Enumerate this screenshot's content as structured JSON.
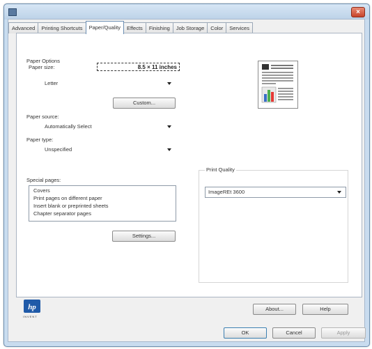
{
  "window": {
    "title": ""
  },
  "tabs": [
    {
      "label": "Advanced",
      "active": false
    },
    {
      "label": "Printing Shortcuts",
      "active": false
    },
    {
      "label": "Paper/Quality",
      "active": true
    },
    {
      "label": "Effects",
      "active": false
    },
    {
      "label": "Finishing",
      "active": false
    },
    {
      "label": "Job Storage",
      "active": false
    },
    {
      "label": "Color",
      "active": false
    },
    {
      "label": "Services",
      "active": false
    }
  ],
  "paper_options": {
    "group_label": "Paper Options",
    "size_label": "Paper size:",
    "size_value": "8.5 × 11 inches",
    "size_combo": "Letter",
    "custom_button": "Custom...",
    "source_label": "Paper source:",
    "source_value": "Automatically Select",
    "type_label": "Paper type:",
    "type_value": "Unspecified"
  },
  "special_pages": {
    "label": "Special pages:",
    "items": [
      "Covers",
      "Print pages on different paper",
      "Insert blank or preprinted sheets",
      "Chapter separator pages"
    ],
    "settings_button": "Settings..."
  },
  "print_quality": {
    "legend": "Print Quality",
    "value": "ImageREt 3600"
  },
  "footer": {
    "about_button": "About...",
    "help_button": "Help",
    "ok_button": "OK",
    "cancel_button": "Cancel",
    "apply_button": "Apply",
    "logo_text": "hp",
    "logo_tagline": "INVENT"
  },
  "colors": {
    "title_bar": "#c9dcef",
    "close_button": "#c7432a",
    "hp_logo": "#1f5aa8"
  }
}
